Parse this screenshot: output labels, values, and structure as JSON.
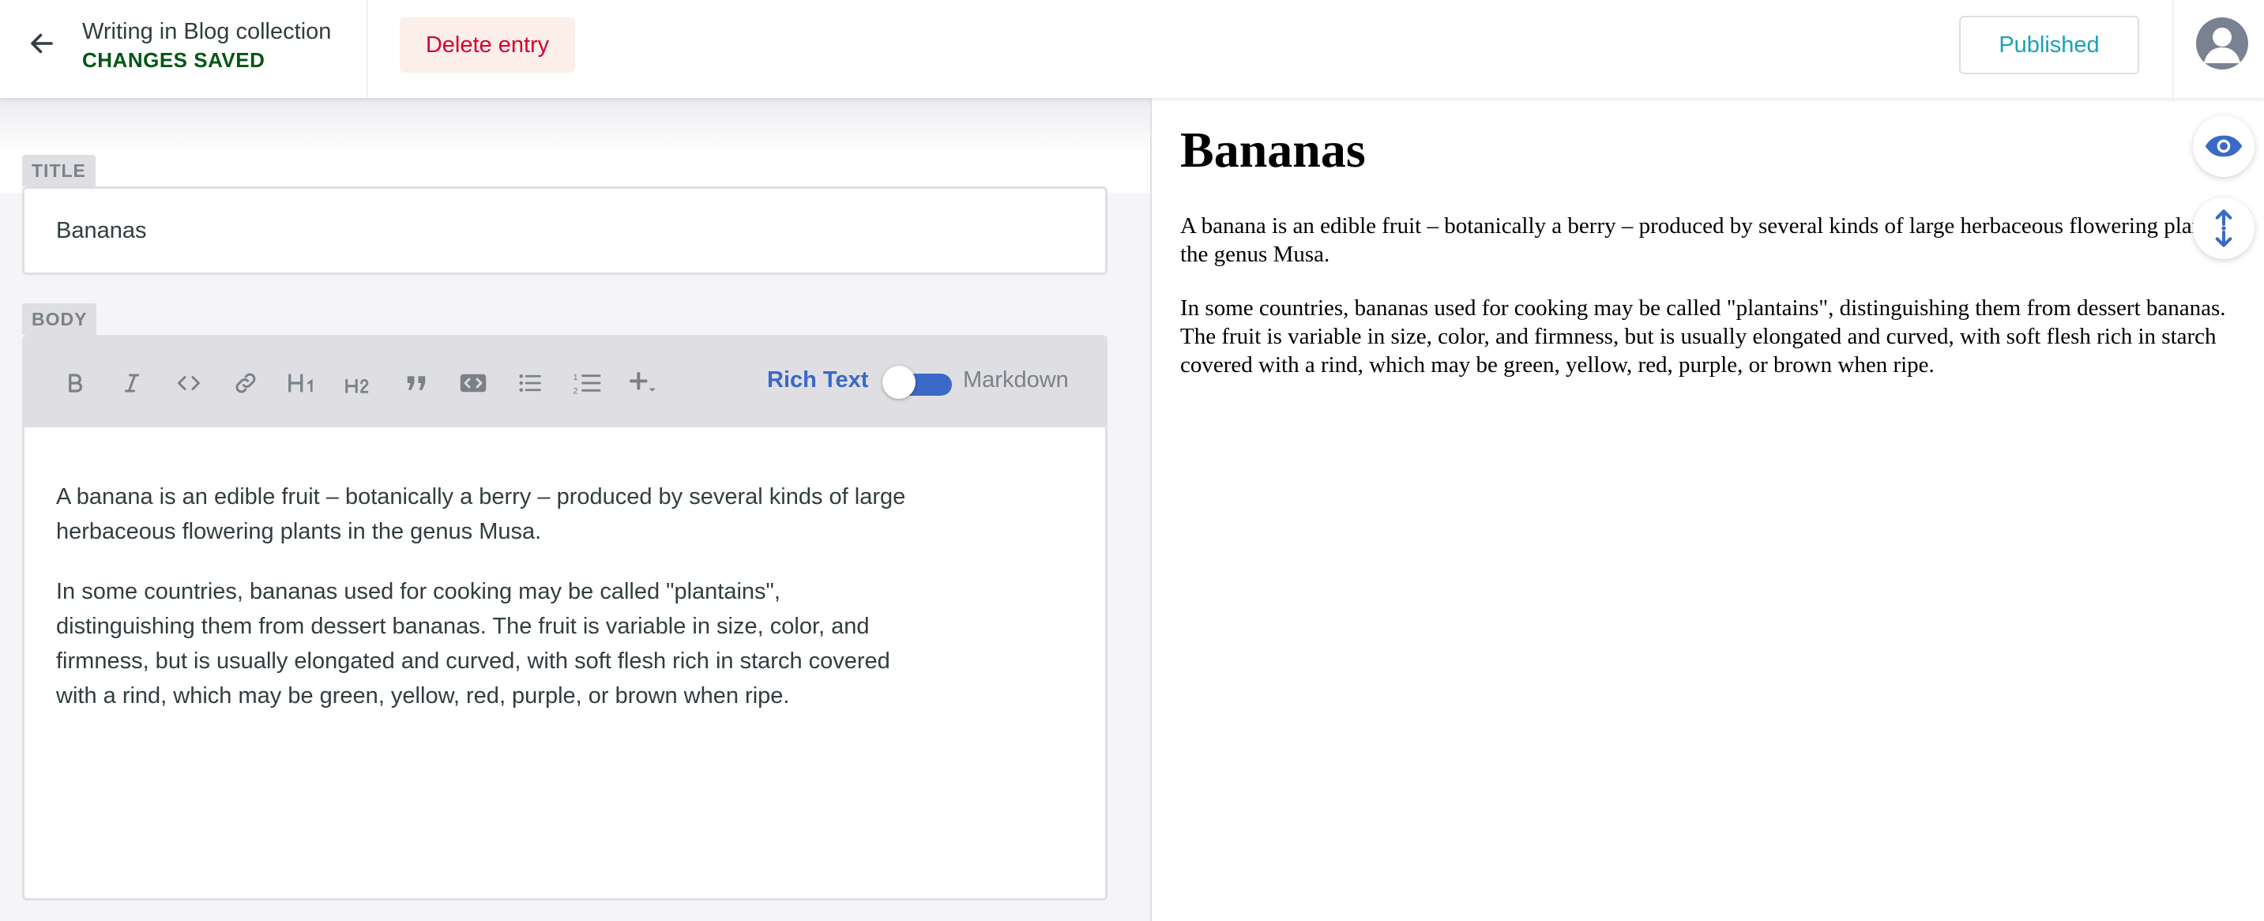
{
  "header": {
    "collection_title": "Writing in Blog collection",
    "saved_status": "CHANGES SAVED",
    "delete_label": "Delete entry",
    "publish_label": "Published",
    "back_icon": "arrow-left-icon",
    "avatar_icon": "user-avatar-icon"
  },
  "editor": {
    "title_label": "TITLE",
    "title_value": "Bananas",
    "body_label": "BODY",
    "toolbar": {
      "buttons": [
        "bold-icon",
        "italic-icon",
        "code-icon",
        "link-icon",
        "heading-1-icon",
        "heading-2-icon",
        "quote-icon",
        "code-block-icon",
        "bulleted-list-icon",
        "numbered-list-icon",
        "add-component-icon"
      ],
      "rich_text_label": "Rich Text",
      "markdown_label": "Markdown",
      "mode": "Rich Text"
    },
    "body_paragraphs": [
      "A banana is an edible fruit – botanically a berry – produced by several kinds of large herbaceous flowering plants in the genus Musa.",
      "In some countries, bananas used for cooking may be called \"plantains\", distinguishing them from dessert bananas. The fruit is variable in size, color, and firmness, but is usually elongated and curved, with soft flesh rich in starch covered with a rind, which may be green, yellow, red, purple, or brown when ripe."
    ]
  },
  "preview": {
    "title": "Bananas",
    "paragraphs": [
      "A banana is an edible fruit – botanically a berry – produced by several kinds of large herbaceous flowering plants in the genus Musa.",
      "In some countries, bananas used for cooking may be called \"plantains\", distinguishing them from dessert bananas. The fruit is variable in size, color, and firmness, but is usually elongated and curved, with soft flesh rich in starch covered with a rind, which may be green, yellow, red, purple, or brown when ripe."
    ],
    "side_buttons": [
      "eye-icon",
      "scroll-sync-icon"
    ]
  },
  "colors": {
    "accent": "#3a69c7",
    "saved": "#005614",
    "danger": "#d60032",
    "published": "#17a2b8"
  }
}
